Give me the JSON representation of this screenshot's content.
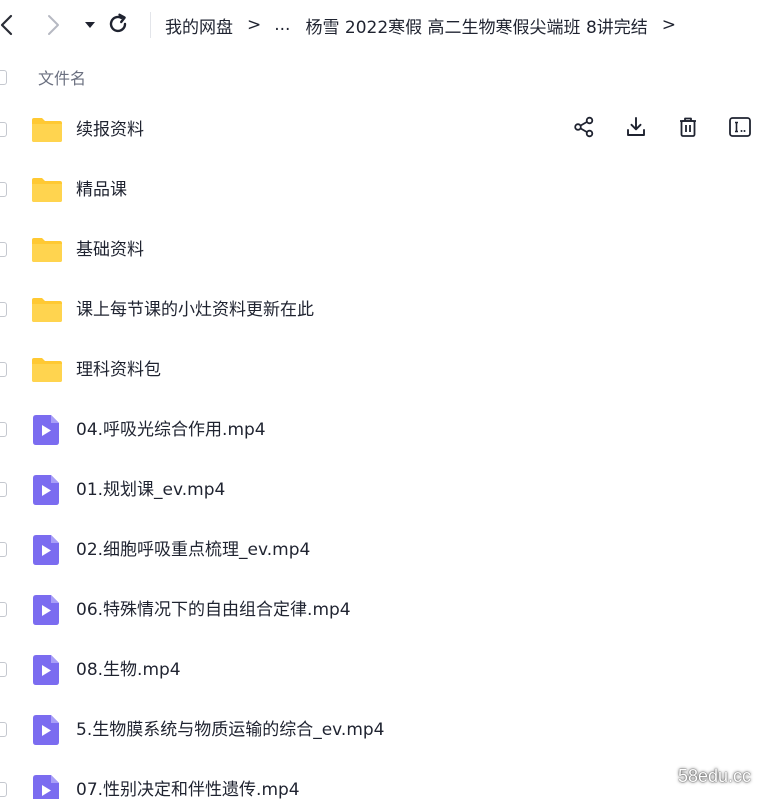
{
  "nav": {
    "back_icon": "chevron-left-icon",
    "forward_icon": "chevron-right-icon",
    "history_icon": "caret-down-icon",
    "refresh_icon": "refresh-icon"
  },
  "breadcrumb": {
    "root": "我的网盘",
    "ellipsis": "...",
    "current": "杨雪 2022寒假 高二生物寒假尖端班 8讲完结",
    "separator": ">"
  },
  "list": {
    "header_label": "文件名",
    "actions": [
      "share-icon",
      "download-icon",
      "delete-icon",
      "rename-icon"
    ],
    "items": [
      {
        "type": "folder",
        "name": "续报资料"
      },
      {
        "type": "folder",
        "name": "精品课"
      },
      {
        "type": "folder",
        "name": "基础资料"
      },
      {
        "type": "folder",
        "name": "课上每节课的小灶资料更新在此"
      },
      {
        "type": "folder",
        "name": "理科资料包"
      },
      {
        "type": "video",
        "name": "04.呼吸光综合作用.mp4"
      },
      {
        "type": "video",
        "name": "01.规划课_ev.mp4"
      },
      {
        "type": "video",
        "name": "02.细胞呼吸重点梳理_ev.mp4"
      },
      {
        "type": "video",
        "name": "06.特殊情况下的自由组合定律.mp4"
      },
      {
        "type": "video",
        "name": "08.生物.mp4"
      },
      {
        "type": "video",
        "name": "5.生物膜系统与物质运输的综合_ev.mp4"
      },
      {
        "type": "video",
        "name": "07.性别决定和伴性遗传.mp4"
      }
    ]
  },
  "colors": {
    "folder": "#ffc933",
    "video": "#7b6cf0"
  },
  "watermark": "58edu.cc"
}
